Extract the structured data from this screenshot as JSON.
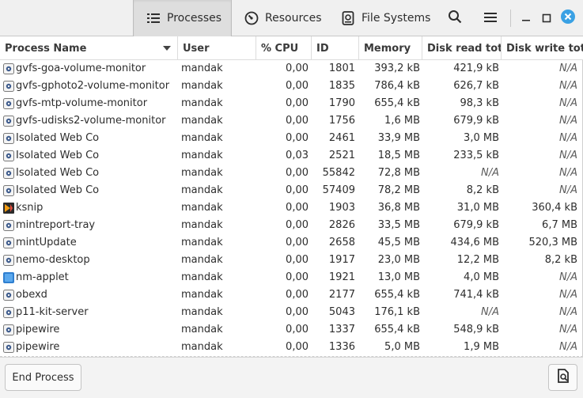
{
  "tabs": [
    {
      "label": "Processes",
      "icon": "list-icon",
      "active": true
    },
    {
      "label": "Resources",
      "icon": "gauge-icon",
      "active": false
    },
    {
      "label": "File Systems",
      "icon": "disk-icon",
      "active": false
    }
  ],
  "window_controls": {
    "close_color": "#3aa1e4"
  },
  "columns": [
    "Process Name",
    "User",
    "% CPU",
    "ID",
    "Memory",
    "Disk read total",
    "Disk write tota"
  ],
  "rows": [
    {
      "name": "gvfs-goa-volume-monitor",
      "icon": "gear-icon",
      "user": "mandak",
      "cpu": "0,00",
      "id": "1801",
      "memory": "393,2 kB",
      "read": "421,9 kB",
      "write": "N/A"
    },
    {
      "name": "gvfs-gphoto2-volume-monitor",
      "icon": "gear-icon",
      "user": "mandak",
      "cpu": "0,00",
      "id": "1835",
      "memory": "786,4 kB",
      "read": "626,7 kB",
      "write": "N/A"
    },
    {
      "name": "gvfs-mtp-volume-monitor",
      "icon": "gear-icon",
      "user": "mandak",
      "cpu": "0,00",
      "id": "1790",
      "memory": "655,4 kB",
      "read": "98,3 kB",
      "write": "N/A"
    },
    {
      "name": "gvfs-udisks2-volume-monitor",
      "icon": "gear-icon",
      "user": "mandak",
      "cpu": "0,00",
      "id": "1756",
      "memory": "1,6 MB",
      "read": "679,9 kB",
      "write": "N/A"
    },
    {
      "name": "Isolated Web Co",
      "icon": "gear-icon",
      "user": "mandak",
      "cpu": "0,00",
      "id": "2461",
      "memory": "33,9 MB",
      "read": "3,0 MB",
      "write": "N/A"
    },
    {
      "name": "Isolated Web Co",
      "icon": "gear-icon",
      "user": "mandak",
      "cpu": "0,03",
      "id": "2521",
      "memory": "18,5 MB",
      "read": "233,5 kB",
      "write": "N/A"
    },
    {
      "name": "Isolated Web Co",
      "icon": "gear-icon",
      "user": "mandak",
      "cpu": "0,00",
      "id": "55842",
      "memory": "72,8 MB",
      "read": "N/A",
      "write": "N/A"
    },
    {
      "name": "Isolated Web Co",
      "icon": "gear-icon",
      "user": "mandak",
      "cpu": "0,00",
      "id": "57409",
      "memory": "78,2 MB",
      "read": "8,2 kB",
      "write": "N/A"
    },
    {
      "name": "ksnip",
      "icon": "ksnip-icon",
      "user": "mandak",
      "cpu": "0,00",
      "id": "1903",
      "memory": "36,8 MB",
      "read": "31,0 MB",
      "write": "360,4 kB"
    },
    {
      "name": "mintreport-tray",
      "icon": "gear-icon",
      "user": "mandak",
      "cpu": "0,00",
      "id": "2826",
      "memory": "33,5 MB",
      "read": "679,9 kB",
      "write": "6,7 MB"
    },
    {
      "name": "mintUpdate",
      "icon": "gear-icon",
      "user": "mandak",
      "cpu": "0,00",
      "id": "2658",
      "memory": "45,5 MB",
      "read": "434,6 MB",
      "write": "520,3 MB"
    },
    {
      "name": "nemo-desktop",
      "icon": "gear-icon",
      "user": "mandak",
      "cpu": "0,00",
      "id": "1917",
      "memory": "23,0 MB",
      "read": "12,2 MB",
      "write": "8,2 kB"
    },
    {
      "name": "nm-applet",
      "icon": "network-icon",
      "user": "mandak",
      "cpu": "0,00",
      "id": "1921",
      "memory": "13,0 MB",
      "read": "4,0 MB",
      "write": "N/A"
    },
    {
      "name": "obexd",
      "icon": "gear-icon",
      "user": "mandak",
      "cpu": "0,00",
      "id": "2177",
      "memory": "655,4 kB",
      "read": "741,4 kB",
      "write": "N/A"
    },
    {
      "name": "p11-kit-server",
      "icon": "gear-icon",
      "user": "mandak",
      "cpu": "0,00",
      "id": "5043",
      "memory": "176,1 kB",
      "read": "N/A",
      "write": "N/A"
    },
    {
      "name": "pipewire",
      "icon": "gear-icon",
      "user": "mandak",
      "cpu": "0,00",
      "id": "1337",
      "memory": "655,4 kB",
      "read": "548,9 kB",
      "write": "N/A"
    },
    {
      "name": "pipewire",
      "icon": "gear-icon",
      "user": "mandak",
      "cpu": "0,00",
      "id": "1336",
      "memory": "5,0 MB",
      "read": "1,9 MB",
      "write": "N/A"
    }
  ],
  "footer": {
    "end_process_label": "End Process",
    "properties_icon": "properties-icon"
  }
}
